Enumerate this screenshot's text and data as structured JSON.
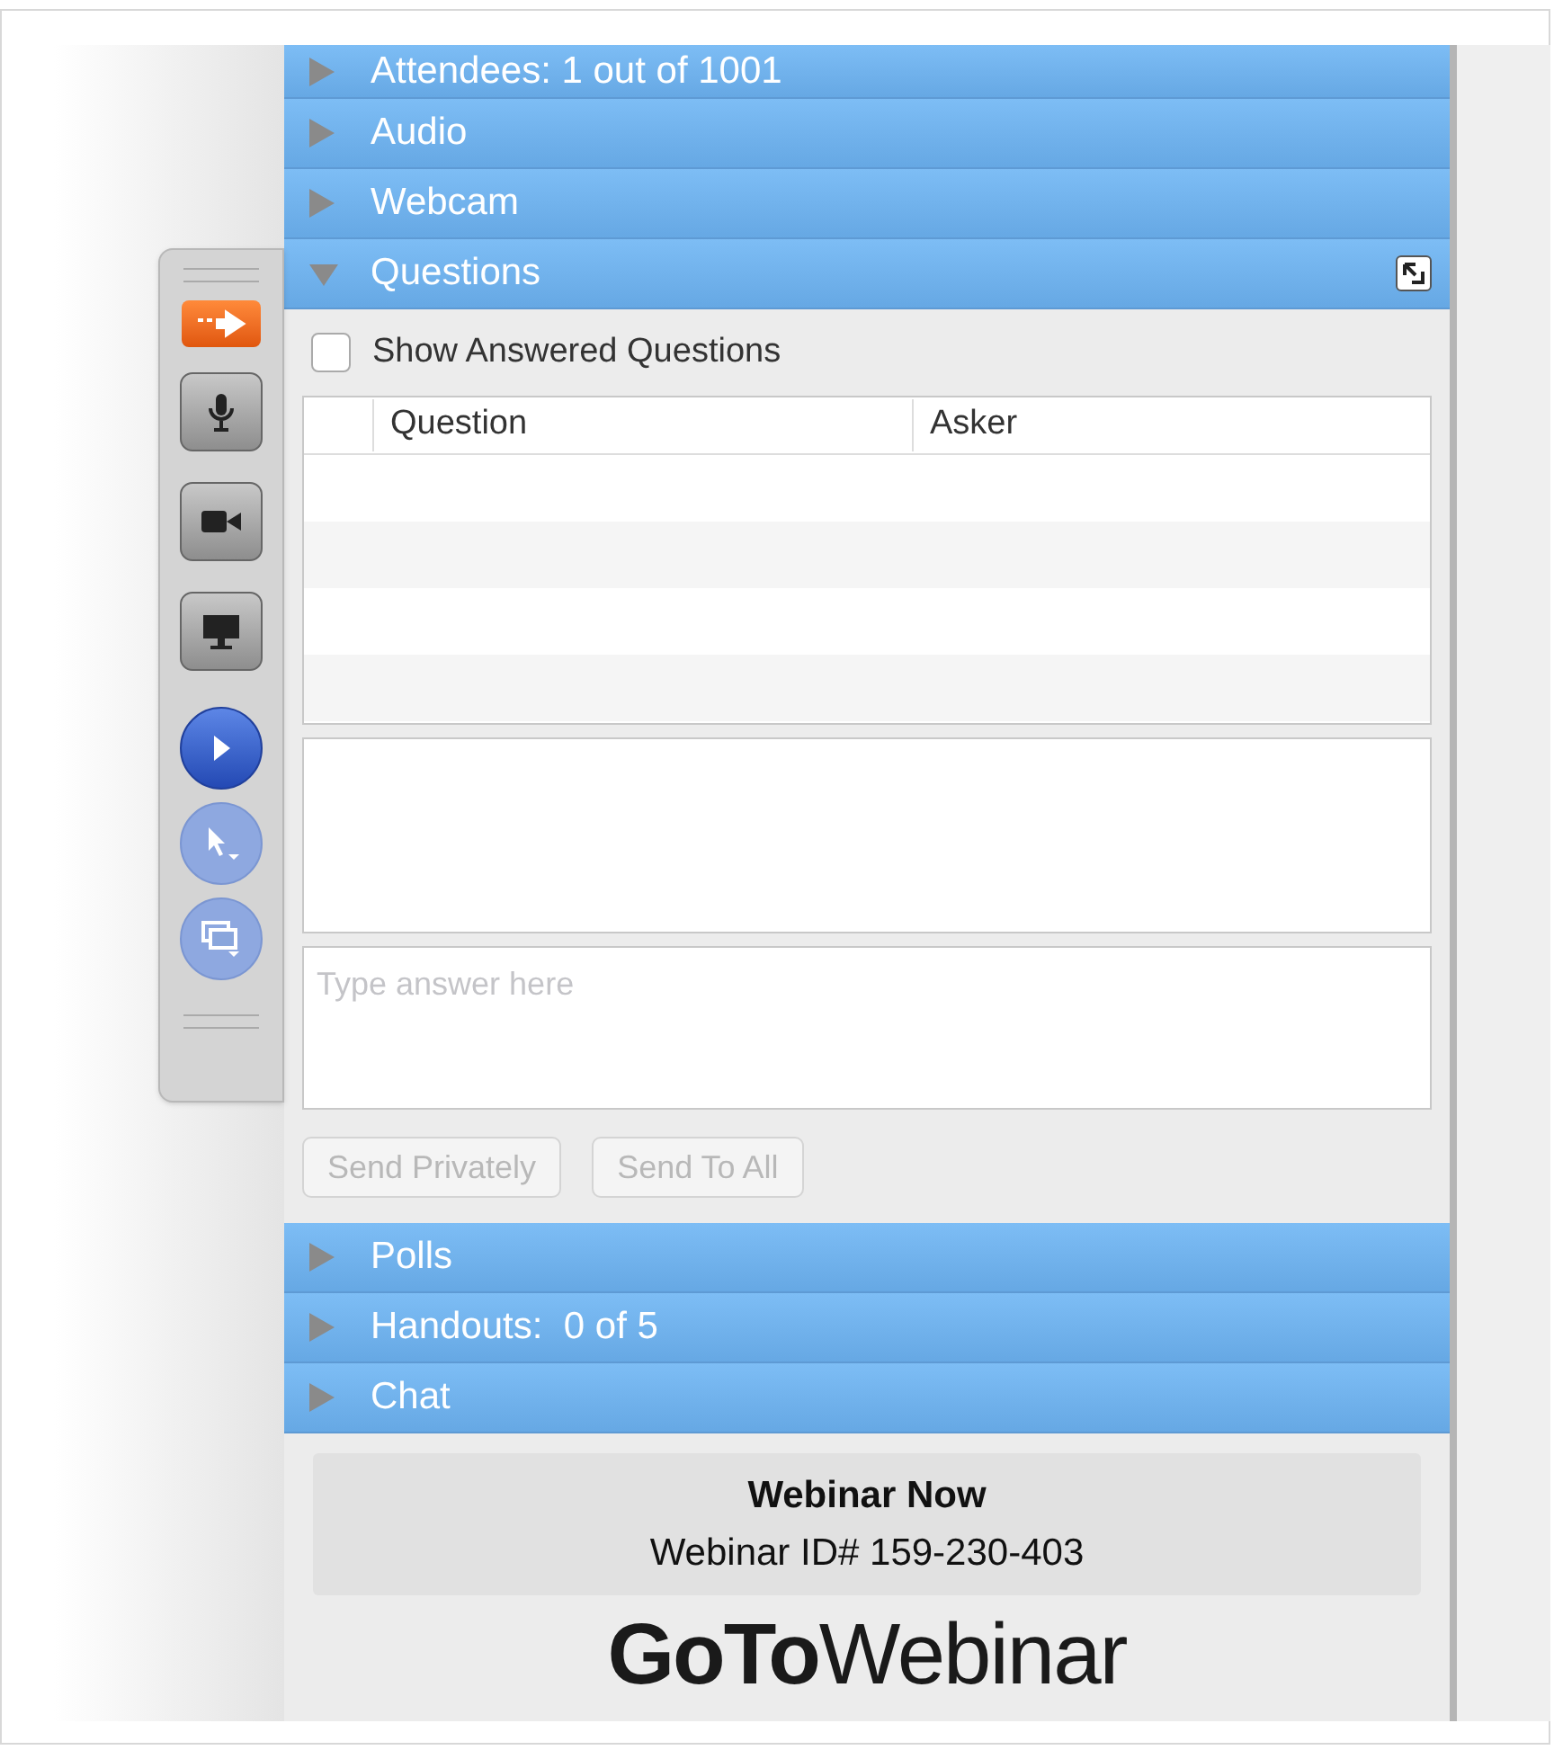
{
  "toolbar": [
    {
      "kind": "arrow",
      "disabled": false
    },
    {
      "kind": "mic",
      "disabled": false
    },
    {
      "kind": "camera",
      "disabled": false
    },
    {
      "kind": "screen",
      "disabled": false
    },
    {
      "kind": "play",
      "disabled": false
    },
    {
      "kind": "pointer",
      "disabled": true
    },
    {
      "kind": "screens",
      "disabled": true
    }
  ],
  "sections_top": [
    {
      "title": "Attendees: 1 out of 1001",
      "expanded": false
    },
    {
      "title": "Audio",
      "expanded": false
    },
    {
      "title": "Webcam",
      "expanded": false
    },
    {
      "title": "Questions",
      "expanded": true
    }
  ],
  "questions": {
    "show_answered": {
      "label": "Show Answered Questions",
      "checked": false
    },
    "table": {
      "columns": [
        "Question",
        "Asker"
      ]
    },
    "answer": {
      "placeholder": "Type answer here"
    },
    "buttons": [
      {
        "label": "Send Privately",
        "disabled": true
      },
      {
        "label": "Send To All",
        "disabled": true
      }
    ]
  },
  "sections_bottom": [
    {
      "title": "Polls",
      "expanded": false
    },
    {
      "title": "Handouts:  0 of 5",
      "expanded": false
    },
    {
      "title": "Chat",
      "expanded": false
    }
  ],
  "footer": {
    "title": "Webinar Now",
    "id_line": "Webinar ID# 159-230-403",
    "logo_bold": "GoTo",
    "logo_light": "Webinar"
  }
}
